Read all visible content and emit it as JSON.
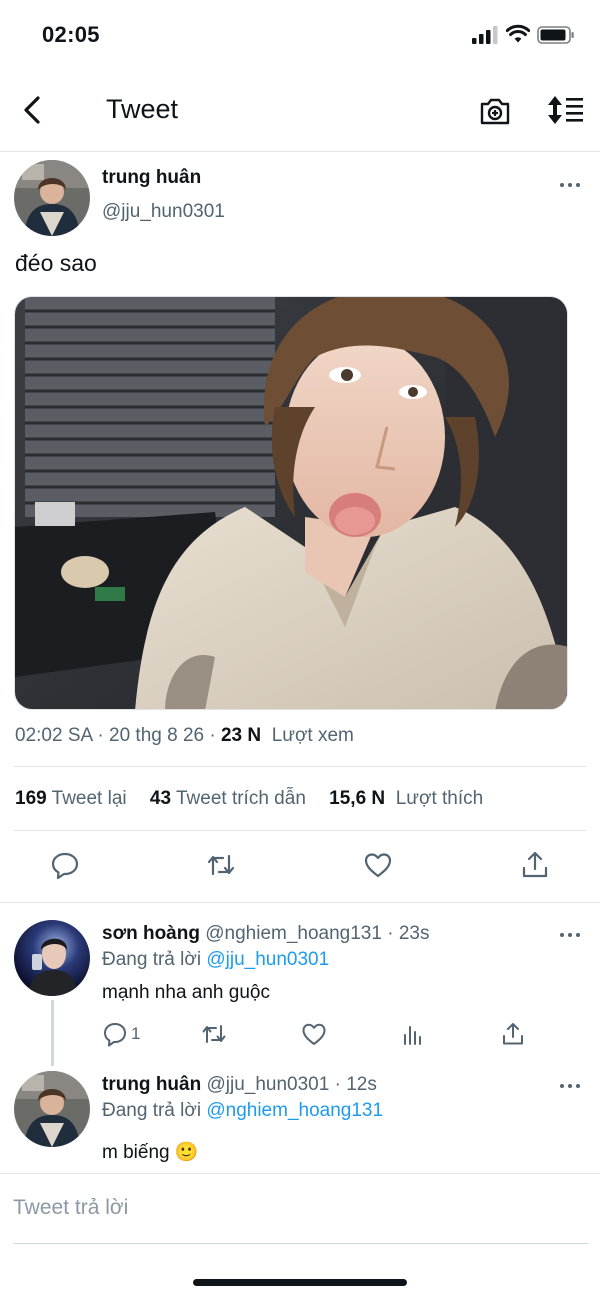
{
  "status_bar": {
    "time": "02:05"
  },
  "header": {
    "title": "Tweet"
  },
  "tweet": {
    "author_name": "trung huân",
    "author_handle": "@jju_hun0301",
    "text": "đéo sao",
    "meta_time_date": "02:02 SA · 20 thg 8 26 · ",
    "views_count": "23 N",
    "views_label": "Lượt xem",
    "stats": {
      "retweets_count": "169",
      "retweets_label": "Tweet lại",
      "quotes_count": "43",
      "quotes_label": "Tweet trích dẫn",
      "likes_count": "15,6 N",
      "likes_label": "Lượt thích"
    }
  },
  "replies": [
    {
      "name": "sơn hoàng",
      "handle_time": "@nghiem_hoang131 · 23s",
      "context_prefix": "Đang trả lời ",
      "context_handle": "@jju_hun0301",
      "text": "mạnh nha anh guộc",
      "reply_count": "1"
    },
    {
      "name": "trung huân",
      "handle_time": "@jju_hun0301 · 12s",
      "context_prefix": "Đang trả lời ",
      "context_handle": "@nghiem_hoang131",
      "text": "m biếng 🙂"
    }
  ],
  "compose": {
    "placeholder": "Tweet trả lời"
  },
  "colors": {
    "accent": "#1d9bf0",
    "secondary_text": "#536471",
    "primary_text": "#0f1419"
  },
  "icons": [
    "signal-icon",
    "wifi-icon",
    "battery-icon",
    "back-arrow-icon",
    "camera-icon",
    "sort-icon",
    "more-icon",
    "reply-icon",
    "retweet-icon",
    "like-icon",
    "share-icon",
    "analytics-icon"
  ]
}
